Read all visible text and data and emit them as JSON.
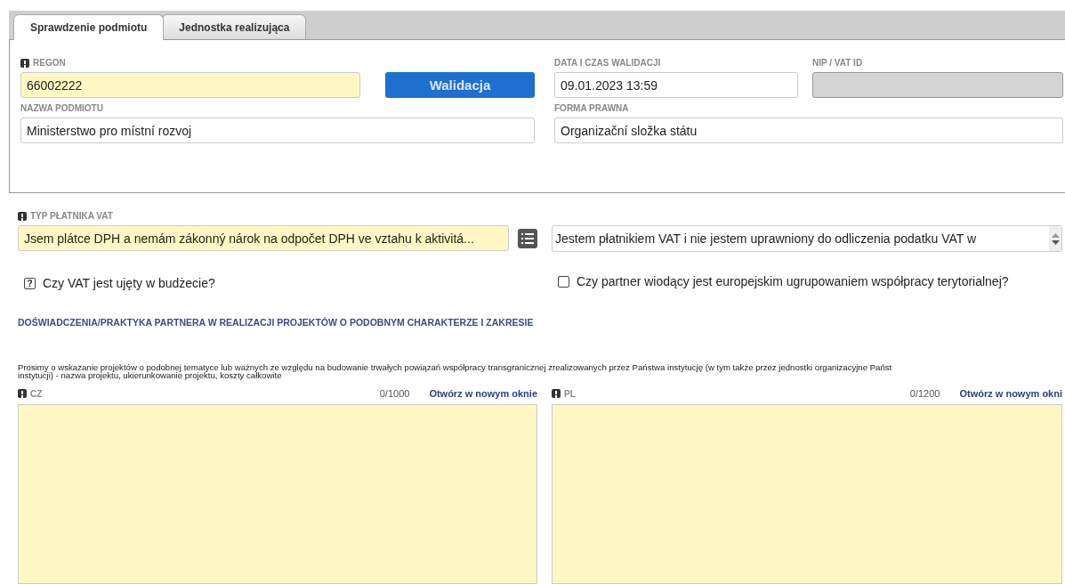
{
  "tabs": [
    {
      "label": "Sprawdzenie podmiotu",
      "selected": true
    },
    {
      "label": "Jednostka realizująca",
      "selected": false
    }
  ],
  "entity": {
    "regon": {
      "label": "REGON",
      "required": true,
      "value": "66002222"
    },
    "validate_button": "Walidacja",
    "validation_time": {
      "label": "DATA I CZAS WALIDACJI",
      "value": "09.01.2023 13:59"
    },
    "vat_id": {
      "label": "NIP / VAT ID",
      "disabled": true
    },
    "name": {
      "label": "NAZWA PODMIOTU",
      "value": "Ministerstwo pro místní rozvoj"
    },
    "legal_form": {
      "label": "FORMA PRAWNA",
      "value": "Organizační složka státu"
    }
  },
  "vat_type": {
    "label": "TYP PŁATNIKA VAT",
    "required": true,
    "value": "Jsem plátce DPH a nemám zákonný nárok na odpočet DPH ve vztahu k aktivitá...",
    "description": "Jestem płatnikiem VAT i nie jestem uprawniony do odliczenia podatku VAT w"
  },
  "checkboxes": [
    {
      "label": "Czy VAT jest ujęty w budżecie?",
      "mark": "?"
    },
    {
      "label": "Czy partner wiodący jest europejskim ugrupowaniem współpracy terytorialnej?",
      "checked": false
    }
  ],
  "experience": {
    "heading": "DOŚWIADCZENIA/PRAKTYKA PARTNERA W REALIZACJI PROJEKTÓW O PODOBNYM CHARAKTERZE I ZAKRESIE",
    "instructions": [
      "Prosimy o wskazanie projektów o podobnej tematyce lub ważnych ze względu na budowanie trwałych powiązań współpracy transgranicznej zrealizowanych przez Państwa instytucję (w tym także przez jednostki organizacyjne Państ",
      "instytucji) - nazwa projektu, ukierunkowanie projektu, koszty całkowite"
    ],
    "fields": [
      {
        "label": "CZ",
        "required": true,
        "counter": "0/1000",
        "link": "Otwórz w nowym oknie"
      },
      {
        "label": "PL",
        "required": true,
        "counter": "0/1200",
        "link": "Otwórz w nowym okni"
      }
    ]
  }
}
